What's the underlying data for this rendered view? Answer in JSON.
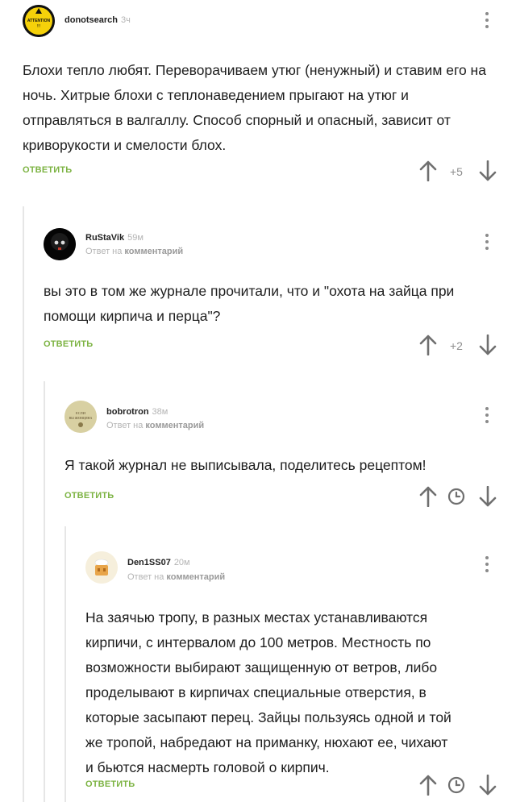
{
  "comments": [
    {
      "author": "donotsearch",
      "time": "3ч",
      "reply_prefix": "",
      "reply_target": "",
      "text": "Блохи тепло любят. Переворачиваем утюг (ненужный) и ставим его на ночь. Хитрые блохи с теплонаведением прыгают на утюг и отправляться в валгаллу. Способ спорный и опасный, зависит от криворукости и смелости блох.",
      "reply_label": "ОТВЕТИТЬ",
      "score": "+5"
    },
    {
      "author": "RuStaVik",
      "time": "59м",
      "reply_prefix": "Ответ на",
      "reply_target": "комментарий",
      "text": "вы это в том же журнале прочитали, что и \"охота на зайца при помощи кирпича и перца\"?",
      "reply_label": "ОТВЕТИТЬ",
      "score": "+2"
    },
    {
      "author": "bobrotron",
      "time": "38м",
      "reply_prefix": "Ответ на",
      "reply_target": "комментарий",
      "text": "Я такой журнал не выписывала, поделитесь рецептом!",
      "reply_label": "ОТВЕТИТЬ",
      "score": ""
    },
    {
      "author": "Den1SS07",
      "time": "20м",
      "reply_prefix": "Ответ на",
      "reply_target": "комментарий",
      "text": "На заячью тропу, в разных местах устанавливаются кирпичи, с интервалом до 100 метров. Местность по возможности выбирают защищенную от ветров, либо проделывают в кирпичах специальные отверстия, в которые засыпают перец. Зайцы пользуясь одной и той же тропой, набредают на приманку, нюхают ее, чихают и бьются насмерть головой о кирпич.",
      "reply_label": "ОТВЕТИТЬ",
      "score": ""
    }
  ],
  "avatars": {
    "donotsearch": {
      "line1": "ATTENTION",
      "line2": "!!!",
      "bg": "#f5d10a"
    },
    "bobrotron": {
      "line1": "ЕСЛИ",
      "line2": "ВЫ ЖЕНЩИНА",
      "bg": "#d8d0a2"
    }
  },
  "colors": {
    "accent": "#7cb342",
    "muted": "#b4b4b4",
    "text": "#1e1e1e"
  },
  "icons": [
    "arrow-up-icon",
    "arrow-down-icon",
    "clock-icon",
    "more-vertical-icon"
  ]
}
